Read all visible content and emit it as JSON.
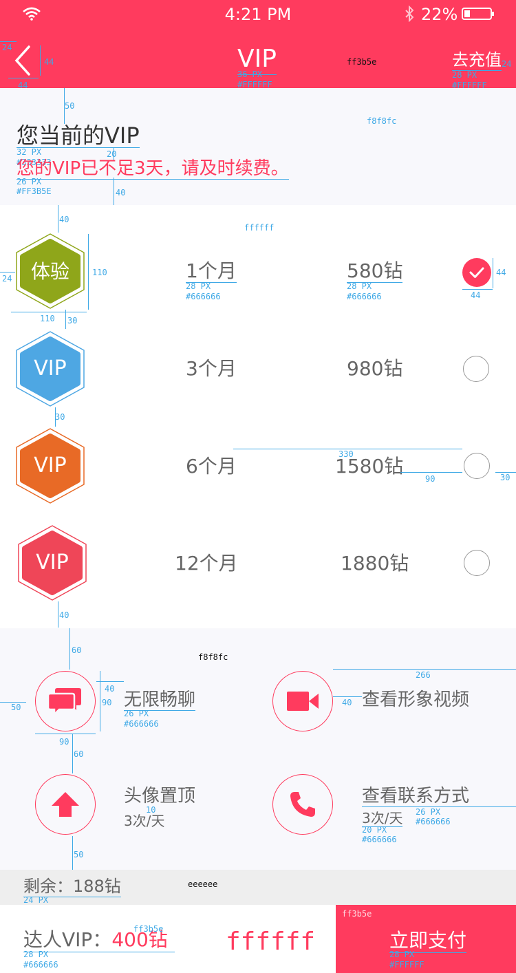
{
  "status_bar": {
    "time": "4:21 PM",
    "battery": "22%",
    "icons": [
      "wifi-icon",
      "bluetooth-icon",
      "battery-icon"
    ]
  },
  "header": {
    "title": "VIP",
    "right_action": "去充值",
    "bg_color": "#ff3b5e",
    "color_note": "ff3b5e",
    "ann_title": {
      "size": "36 PX",
      "color": "#FFFFFF"
    },
    "ann_right": {
      "size": "28 PX",
      "color": "#FFFFFF"
    }
  },
  "current": {
    "heading": "您当前的VIP",
    "notice": "您的VIP已不足3天，请及时续费。",
    "bg_note": "f8f8fc",
    "ann_heading": {
      "size": "32 PX",
      "color": "#333333"
    },
    "ann_notice": {
      "size": "26 PX",
      "color": "#FF3B5E"
    }
  },
  "plans_bg_note": "ffffff",
  "plans": [
    {
      "badge": "体验",
      "duration": "1个月",
      "price": "580钻",
      "selected": true,
      "color": "#8fa61a"
    },
    {
      "badge": "VIP",
      "duration": "3个月",
      "price": "980钻",
      "selected": false,
      "color": "#4ea7e3"
    },
    {
      "badge": "VIP",
      "duration": "6个月",
      "price": "1580钻",
      "selected": false,
      "color": "#e86a26"
    },
    {
      "badge": "VIP",
      "duration": "12个月",
      "price": "1880钻",
      "selected": false,
      "color": "#ef4658"
    }
  ],
  "plan_ann": {
    "size": "28 PX",
    "color": "#666666"
  },
  "features_bg_note": "f8f8fc",
  "features": [
    {
      "title": "无限畅聊",
      "sub": "",
      "icon": "chat-icon"
    },
    {
      "title": "查看形象视频",
      "sub": "",
      "icon": "video-camera-icon"
    },
    {
      "title": "头像置顶",
      "sub": "3次/天",
      "icon": "arrow-up-icon"
    },
    {
      "title": "查看联系方式",
      "sub": "3次/天",
      "icon": "phone-icon"
    }
  ],
  "feat_ann": {
    "title_size": "26 PX",
    "title_color": "#666666",
    "sub_size": "20 PX",
    "sub_color": "#666666"
  },
  "balance": {
    "text": "剩余：188钻",
    "bg_note": "eeeeee",
    "ann": {
      "size": "24 PX",
      "color": "#666666"
    }
  },
  "footer": {
    "label": "达人VIP：",
    "amount": "400钻",
    "amount_color_note": "ff3b5e",
    "white_note": "ffffff",
    "pay_button": "立即支付",
    "pay_color_note": "ff3b5e",
    "ann_left": {
      "size": "28 PX",
      "color": "#666666"
    },
    "ann_pay": {
      "size": "28 PX",
      "color": "#FFFFFF"
    }
  },
  "measures": {
    "m24": "24",
    "m44": "44",
    "m50": "50",
    "m20": "20",
    "m40": "40",
    "m110": "110",
    "m30": "30",
    "m330": "330",
    "m90": "90",
    "m60": "60",
    "m266": "266",
    "m10": "10"
  }
}
